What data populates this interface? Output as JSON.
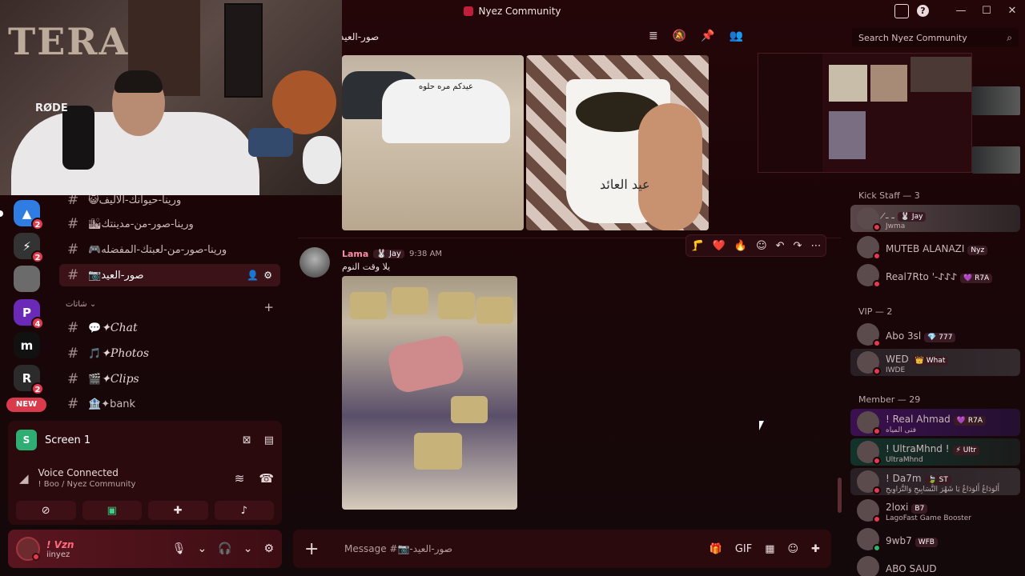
{
  "window": {
    "title": "Nyez Community",
    "controls": [
      "—",
      "☐",
      "✕"
    ]
  },
  "webcam": {
    "wall_text": "TERA",
    "mic_brand": "RØDE"
  },
  "server_rail": {
    "new_label": "NEW",
    "servers": [
      {
        "glyph": "▲",
        "color": "#2f7de3",
        "badge": "2"
      },
      {
        "glyph": "⚡",
        "color": "#333333",
        "badge": "2"
      },
      {
        "glyph": "",
        "color": "#6b6b6b",
        "badge": ""
      },
      {
        "glyph": "P",
        "color": "#6a2ab7",
        "badge": "4"
      },
      {
        "glyph": "m",
        "color": "#111111",
        "badge": ""
      },
      {
        "glyph": "R",
        "color": "#2b2b2b",
        "badge": "2"
      }
    ]
  },
  "channels": {
    "items": [
      {
        "emoji": "😺",
        "name": "ورينا-حيوانك-الأليف"
      },
      {
        "emoji": "🏙",
        "name": "ورينا-صور-من-مدينتك"
      },
      {
        "emoji": "🎮",
        "name": "ورينا-صور-من-لعبتك-المفضله"
      },
      {
        "emoji": "📷",
        "name": "صور-العيد"
      }
    ],
    "category": "شاتات",
    "chat_items": [
      {
        "emoji": "💬",
        "name": "✦Chat"
      },
      {
        "emoji": "🎵",
        "name": "✦Photos"
      },
      {
        "emoji": "🎬",
        "name": "✦Clips"
      },
      {
        "emoji": "🏦",
        "name": "✦bank"
      }
    ]
  },
  "voice": {
    "screen_label": "Screen 1",
    "status": "Voice Connected",
    "location": "! Boo / Nyez Community"
  },
  "user": {
    "display": "! Vzn",
    "handle": "iinyez"
  },
  "chat": {
    "channel_name": "صور-العيد",
    "car_text": "عيدكم مره حلوه",
    "cup_text": "عيد العائد",
    "message": {
      "author": "Lama",
      "tag": "🐰 Jay",
      "time": "9:38 AM",
      "text": "يلا وقت النوم"
    },
    "composer_placeholder": "Message #📷-صور-العيد",
    "reactions": [
      "🦵",
      "❤️",
      "🔥",
      "☺",
      "↶",
      "↷",
      "⋯"
    ]
  },
  "search": {
    "placeholder": "Search Nyez Community"
  },
  "members": {
    "groups": [
      {
        "heading": "Kick Staff — 3",
        "people": [
          {
            "name": "ـ  ـ̷",
            "tag": "🐰 Jay",
            "sub": "Jwma",
            "style": "hl"
          },
          {
            "name": "MUTEB ALANAZI",
            "tag": "Nyz",
            "sub": "",
            "style": ""
          },
          {
            "name": "Real7Rto '-𐰀𐰀𐰀",
            "tag": "💜 R7A",
            "sub": "",
            "style": ""
          }
        ]
      },
      {
        "heading": "VIP — 2",
        "people": [
          {
            "name": "Abo 3sl",
            "tag": "💎 777",
            "sub": "",
            "style": ""
          },
          {
            "name": "WED",
            "tag": "👑 What",
            "sub": "IWDE",
            "style": "dark"
          }
        ]
      },
      {
        "heading": "Member — 29",
        "people": [
          {
            "name": "! Real Ahmad",
            "tag": "💜 R7A",
            "sub": "فتى المياه",
            "style": "purple"
          },
          {
            "name": "! UltraMhnd !",
            "tag": "⚡ Ultr",
            "sub": "UltraMhnd",
            "style": "teal"
          },
          {
            "name": "! Da7m",
            "tag": "🍃 ST",
            "sub": "أَلوَدَاعُ أَلوَدَاعُ يَا شَهْرَ التَّسَابِيحِ وَالتَّرَاوِيحِ",
            "style": "dark"
          },
          {
            "name": "2loxi",
            "tag": "B7",
            "sub": "LagoFast Game Booster",
            "style": ""
          },
          {
            "name": "9wb7",
            "tag": "WFB",
            "sub": "",
            "style": ""
          },
          {
            "name": "ABO SAUD",
            "tag": "",
            "sub": "",
            "style": ""
          }
        ]
      }
    ]
  }
}
